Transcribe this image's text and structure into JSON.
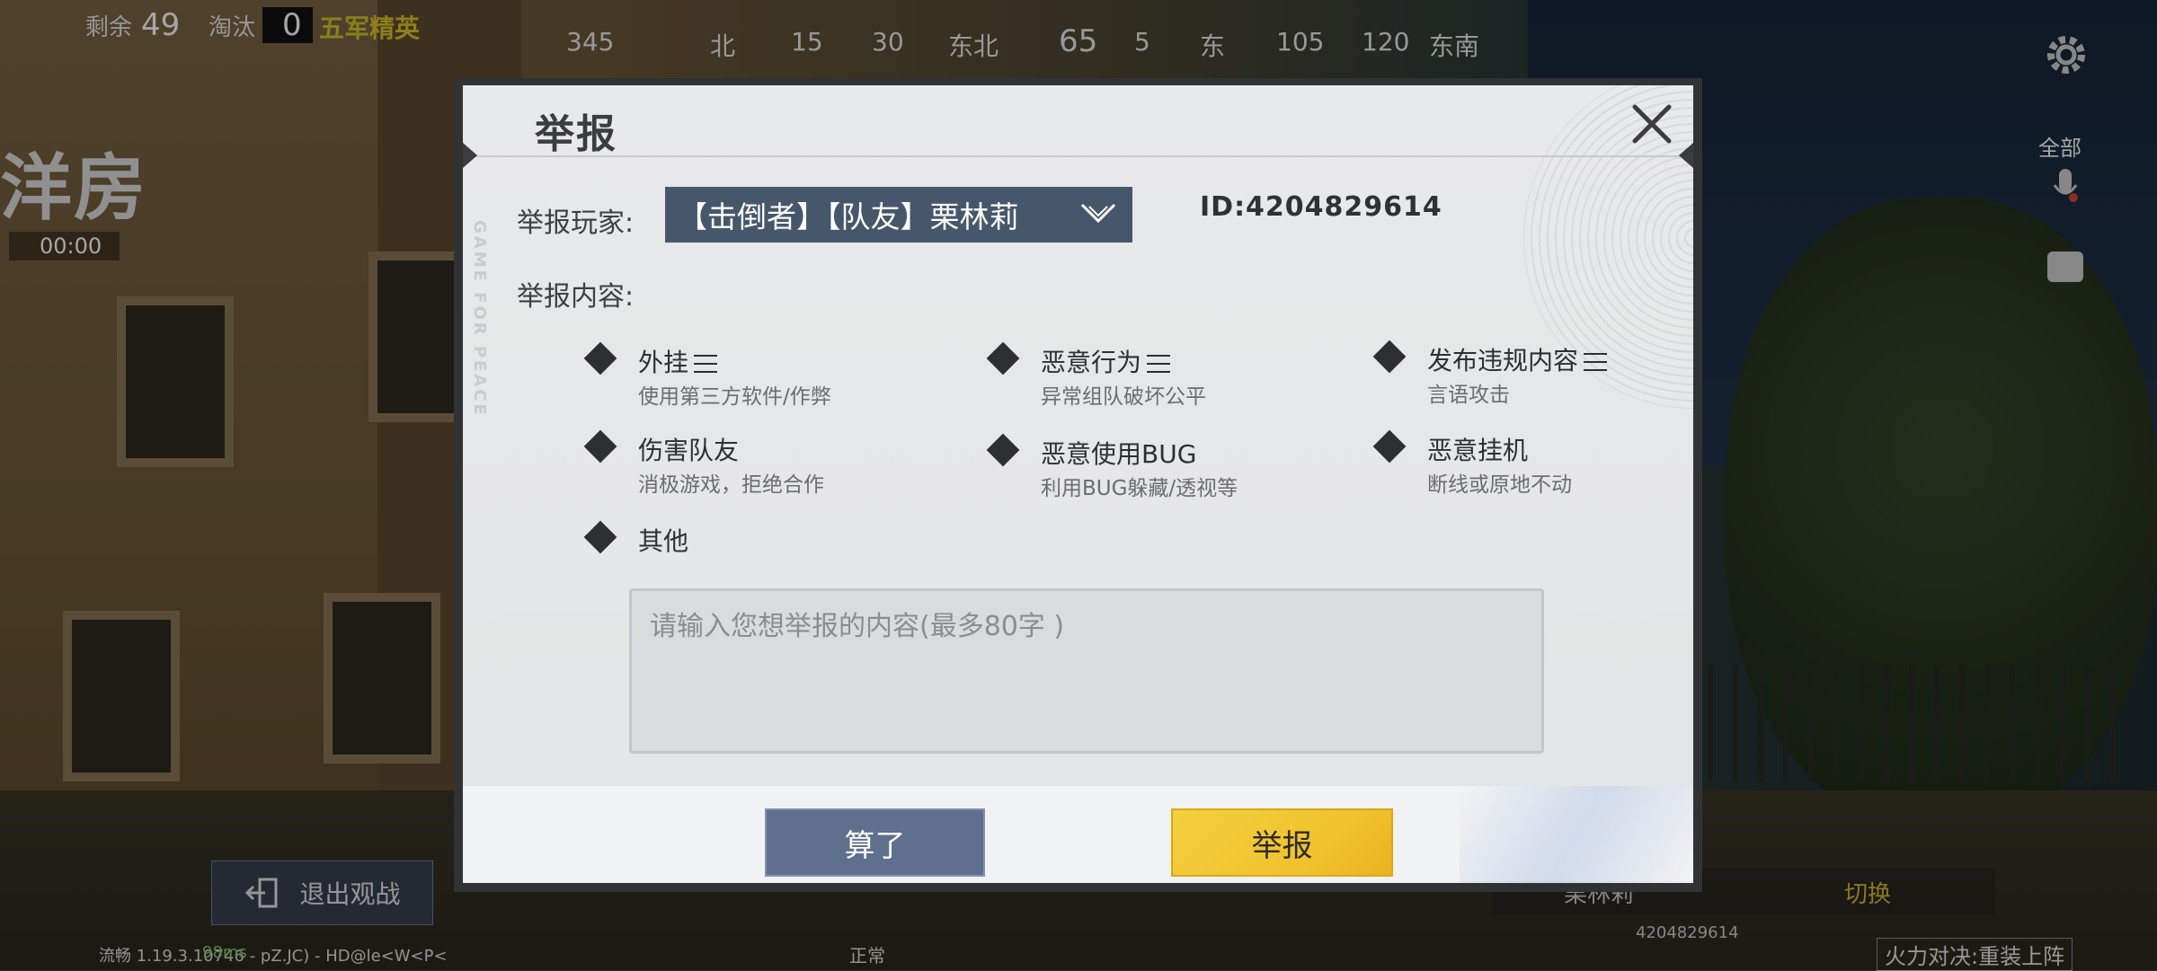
{
  "hud": {
    "remaining_label": "剩余",
    "remaining_value": "49",
    "eliminated_label": "淘汰",
    "eliminated_value": "0",
    "mode_badge": "五军精英",
    "compass": [
      "345",
      "北",
      "15",
      "30",
      "东北",
      "65",
      "5",
      "东",
      "105",
      "120",
      "东南"
    ],
    "location_name": "洋房",
    "timer": "00:00",
    "all_label": "全部",
    "exit_spectate": "退出观战",
    "version_text": "流畅   1.19.3.10746 - pZ.JC) - HD@le<W<P<",
    "ping_text": "98ms",
    "status_normal": "正常",
    "spectate_name": "栗林莉",
    "spectate_switch": "切换",
    "spectate_id": "4204829614",
    "mode_bottom": "火力对决:重装上阵"
  },
  "dialog": {
    "title": "举报",
    "watermark": "GAME FOR PEACE",
    "player_label": "举报玩家:",
    "player_selected": "【击倒者】【队友】栗林莉",
    "player_id": "ID:4204829614",
    "content_label": "举报内容:",
    "options": [
      {
        "name": "外挂",
        "desc": "使用第三方软件/作弊",
        "has_menu": true
      },
      {
        "name": "恶意行为",
        "desc": "异常组队破坏公平",
        "has_menu": true
      },
      {
        "name": "发布违规内容",
        "desc": "言语攻击",
        "has_menu": true
      },
      {
        "name": "伤害队友",
        "desc": "消极游戏，拒绝合作",
        "has_menu": false
      },
      {
        "name": "恶意使用BUG",
        "desc": "利用BUG躲藏/透视等",
        "has_menu": false
      },
      {
        "name": "恶意挂机",
        "desc": "断线或原地不动",
        "has_menu": false
      },
      {
        "name": "其他",
        "desc": "",
        "has_menu": false
      }
    ],
    "textarea_placeholder": "请输入您想举报的内容(最多80字 )",
    "cancel_label": "算了",
    "submit_label": "举报"
  },
  "icons": {
    "close": "close-icon",
    "dropdown": "chevron-down-icon",
    "settings": "gear-icon",
    "exit": "exit-icon",
    "mic": "microphone-icon",
    "chat": "chat-icon"
  }
}
